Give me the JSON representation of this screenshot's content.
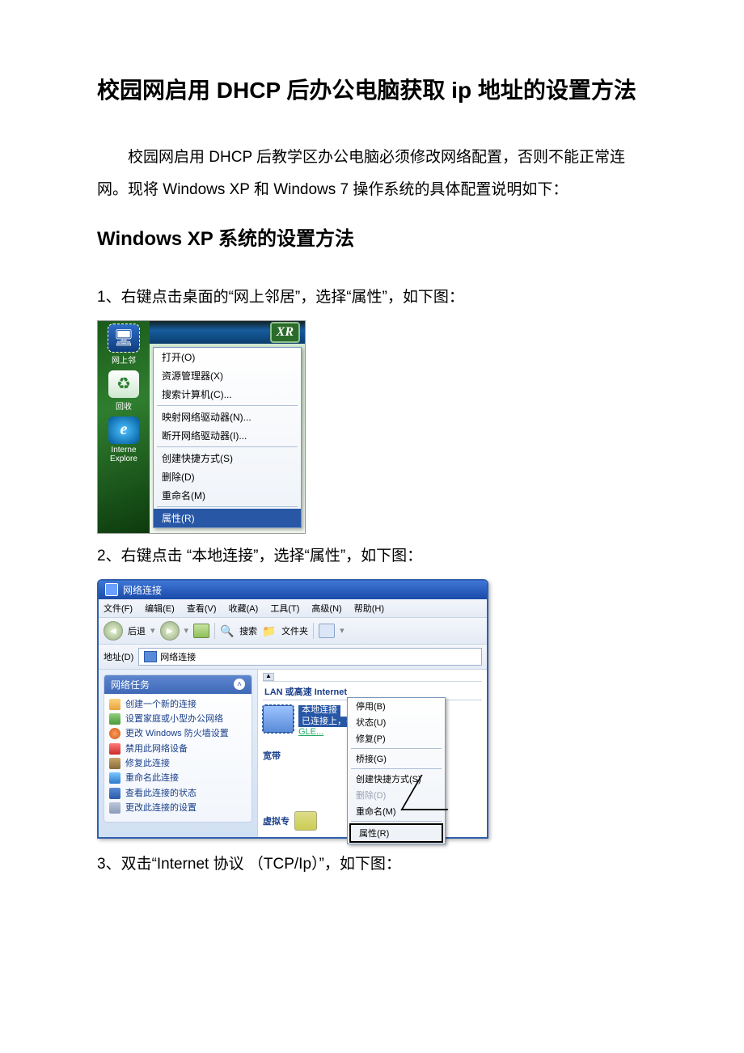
{
  "title": "校园网启用 DHCP 后办公电脑获取 ip 地址的设置方法",
  "intro": "校园网启用 DHCP 后教学区办公电脑必须修改网络配置，否则不能正常连网。现将 Windows XP 和 Windows 7 操作系统的具体配置说明如下：",
  "section1_title": "Windows XP 系统的设置方法",
  "steps": {
    "s1": "1、右键点击桌面的“网上邻居”，选择“属性”，如下图：",
    "s2": "2、右键点击 “本地连接”，选择“属性”，如下图：",
    "s3": "3、双击“Internet 协议 （TCP/Ip）”，如下图："
  },
  "shot1": {
    "desktop_icons": {
      "net": "网上邻",
      "recycle": "回收",
      "ie1": "Interne",
      "ie2": "Explore"
    },
    "xr": "XR",
    "menu": {
      "open": "打开(O)",
      "explorer": "资源管理器(X)",
      "search_pc": "搜索计算机(C)...",
      "map_drive": "映射网络驱动器(N)...",
      "disconnect_drive": "断开网络驱动器(I)...",
      "shortcut": "创建快捷方式(S)",
      "delete": "删除(D)",
      "rename": "重命名(M)",
      "properties": "属性(R)"
    }
  },
  "shot2": {
    "title": "网络连接",
    "menubar": {
      "file": "文件(F)",
      "edit": "编辑(E)",
      "view": "查看(V)",
      "fav": "收藏(A)",
      "tools": "工具(T)",
      "adv": "高级(N)",
      "help": "帮助(H)"
    },
    "toolbar": {
      "back": "后退",
      "search": "搜索",
      "folders": "文件夹"
    },
    "address_label": "地址(D)",
    "address_value": "网络连接",
    "group_header": "LAN 或高速 Internet",
    "panel_title": "网络任务",
    "tasks": {
      "t1": "创建一个新的连接",
      "t2": "设置家庭或小型办公网络",
      "t3": "更改 Windows 防火墙设置",
      "t4": "禁用此网络设备",
      "t5": "修复此连接",
      "t6": "重命名此连接",
      "t7": "查看此连接的状态",
      "t8": "更改此连接的设置"
    },
    "conn": {
      "name": "本地连接",
      "state": "已连接上，有防火墙的",
      "nic": "GLE..."
    },
    "ctx": {
      "disable": "停用(B)",
      "status": "状态(U)",
      "repair": "修复(P)",
      "bridge": "桥接(G)",
      "shortcut": "创建快捷方式(S)",
      "delete": "删除(D)",
      "rename": "重命名(M)",
      "properties": "属性(R)"
    },
    "highspeed_label": "宽带",
    "virtual_label": "虚拟专"
  }
}
